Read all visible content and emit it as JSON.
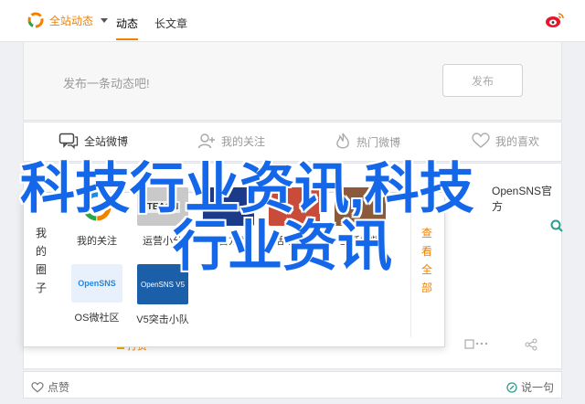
{
  "header": {
    "brand_label": "全站动态",
    "tabs": [
      "动态",
      "长文章"
    ]
  },
  "compose": {
    "placeholder": "发布一条动态吧!",
    "publish_label": "发布"
  },
  "filters": [
    "全站微博",
    "我的关注",
    "热门微博",
    "我的喜欢"
  ],
  "feed": {
    "author": "OpenSNS官方",
    "meta_left": "打赏",
    "like_label": "点赞",
    "say_label": "说一句"
  },
  "popup": {
    "side_left": [
      "我",
      "的",
      "圈",
      "子"
    ],
    "side_right": [
      "查",
      "看",
      "全",
      "部"
    ],
    "tiles": [
      {
        "label": "我的关注",
        "thumb_text": ""
      },
      {
        "label": "运营小分",
        "thumb_text": "TEACH"
      },
      {
        "label": "智营方略",
        "thumb_text": ""
      },
      {
        "label": "活动画廊",
        "thumb_text": ""
      },
      {
        "label": "生活视频",
        "thumb_text": ""
      },
      {
        "label": "OS微社区",
        "thumb_text": "OpenSNS"
      },
      {
        "label": "V5突击小队",
        "thumb_text": "OpenSNS V5"
      }
    ]
  },
  "watermark": {
    "line1": "科技行业资讯,科技",
    "line2": "行业资讯"
  },
  "colors": {
    "accent": "#f08200",
    "watermark": "#1467e8"
  }
}
